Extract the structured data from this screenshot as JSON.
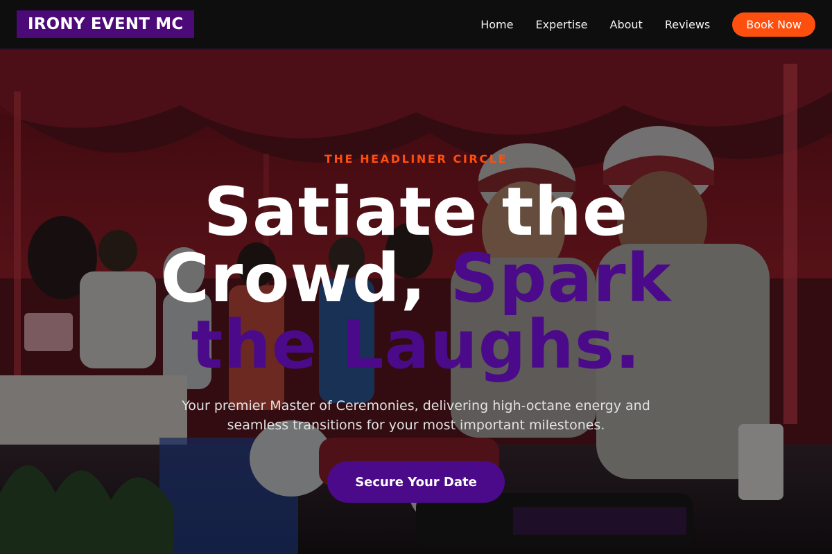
{
  "brand": {
    "logo_text": "IRONY EVENT MC"
  },
  "nav": {
    "links": [
      "Home",
      "Expertise",
      "About",
      "Reviews"
    ],
    "book_label": "Book Now"
  },
  "hero": {
    "eyebrow": "THE HEADLINER CIRCLE",
    "headline_white": "Satiate the Crowd, ",
    "headline_accent": "Spark the Laughs.",
    "subheadline": "Your premier Master of Ceremonies, delivering high-octane energy and seamless transitions for your most important milestones.",
    "cta_label": "Secure Your Date"
  },
  "colors": {
    "nav_bg": "#0e0e0e",
    "brand_purple": "#4b0a8a",
    "accent_orange": "#ff4f0f",
    "text_white": "#ffffff"
  }
}
